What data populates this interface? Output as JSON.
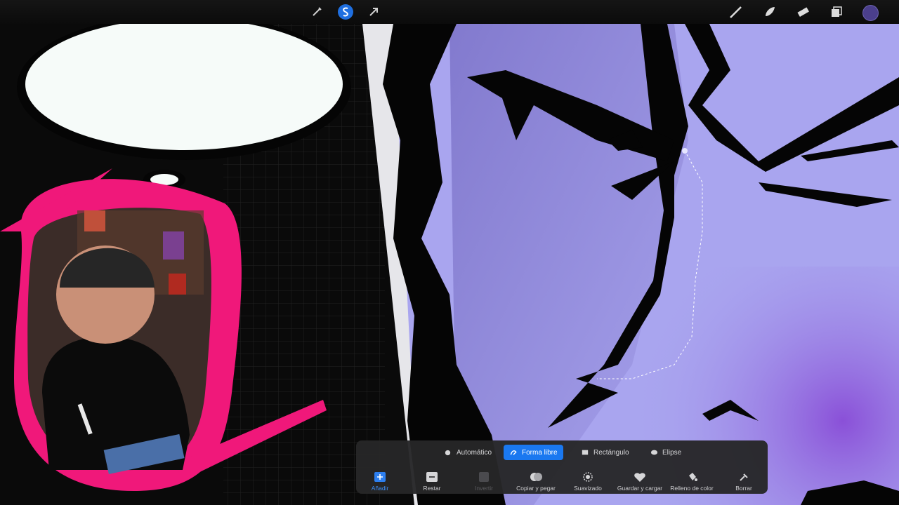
{
  "toolbar": {
    "left_tools": [
      "wrench-icon",
      "magic-wand-icon",
      "selection-icon",
      "transform-arrow-icon"
    ],
    "right_tools": [
      "brush-icon",
      "smudge-icon",
      "eraser-icon",
      "layers-icon"
    ],
    "active_color": "#4b3f8c"
  },
  "selection_panel": {
    "modes": [
      {
        "label": "Automático",
        "icon": "sun-icon"
      },
      {
        "label": "Forma libre",
        "icon": "freehand-icon",
        "active": true
      },
      {
        "label": "Rectángulo",
        "icon": "rectangle-icon"
      },
      {
        "label": "Elipse",
        "icon": "ellipse-icon"
      }
    ],
    "actions": [
      {
        "label": "Añadir",
        "icon": "plus-icon"
      },
      {
        "label": "Restar",
        "icon": "minus-icon"
      },
      {
        "label": "Invertir",
        "icon": "invert-icon"
      },
      {
        "label": "Copiar y pegar",
        "icon": "copy-icon"
      },
      {
        "label": "Suavizado",
        "icon": "feather-icon"
      },
      {
        "label": "Guardar y cargar",
        "icon": "heart-icon"
      },
      {
        "label": "Relleno de color",
        "icon": "fill-icon"
      },
      {
        "label": "Borrar",
        "icon": "clear-icon"
      }
    ]
  },
  "colors": {
    "accent": "#1a78f0",
    "panel_bg": "#262628",
    "art_purple": "#8d86d8",
    "frame_pink": "#f0187a"
  }
}
